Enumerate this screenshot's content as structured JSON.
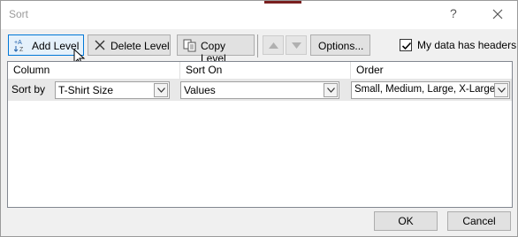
{
  "window": {
    "title": "Sort",
    "help_glyph": "?"
  },
  "toolbar": {
    "add_level": "Add Level",
    "delete_level": "Delete Level",
    "copy_level": "Copy Level",
    "options": "Options...",
    "my_data_has_headers": "My data has headers",
    "my_data_has_headers_checked": true
  },
  "grid": {
    "columns": [
      "Column",
      "Sort On",
      "Order"
    ],
    "rows": [
      {
        "label": "Sort by",
        "column": "T-Shirt Size",
        "sort_on": "Values",
        "order": "Small, Medium, Large, X-Large"
      }
    ]
  },
  "footer": {
    "ok": "OK",
    "cancel": "Cancel"
  },
  "icons": {
    "add_level": "sort-add-icon",
    "delete_level": "delete-x-icon",
    "copy_level": "copy-icon",
    "move_up": "triangle-up-icon",
    "move_down": "triangle-down-icon",
    "close": "close-icon",
    "cursor": "mouse-pointer-icon"
  },
  "colors": {
    "accent_blue": "#0078d7",
    "dialog_bg": "#f0f0f0",
    "row_highlight": "#e8e8e8"
  }
}
